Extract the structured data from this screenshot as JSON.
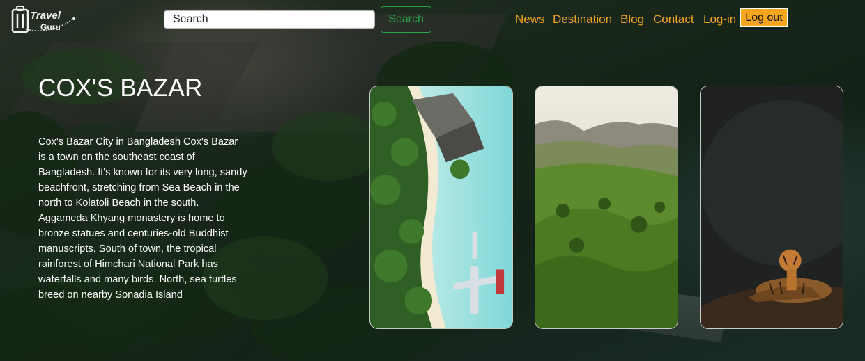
{
  "brand": {
    "name_top": "Travel",
    "name_bottom": "Guru"
  },
  "search": {
    "placeholder": "Search",
    "button_label": "Search"
  },
  "nav": {
    "items": [
      "News",
      "Destination",
      "Blog",
      "Contact",
      "Log-in"
    ],
    "logout_label": "Log out"
  },
  "destination": {
    "title": "COX'S BAZAR",
    "description": "Cox's Bazar City in Bangladesh Cox's Bazar is a town on the southeast coast of Bangladesh. It's known for its very long, sandy beachfront, stretching from Sea Beach in the north to Kolatoli Beach in the south. Aggameda Khyang monastery is home to bronze statues and centuries-old Buddhist manuscripts. South of town, the tropical rainforest of Himchari National Park has waterfalls and many birds. North, sea turtles breed on nearby Sonadia Island"
  },
  "cards": [
    {
      "subject": "beach-aerial"
    },
    {
      "subject": "tea-hills"
    },
    {
      "subject": "tiger"
    }
  ],
  "colors": {
    "nav": "#f0a420",
    "logout_bg": "#f7a51c",
    "search_button": "#28a745"
  }
}
